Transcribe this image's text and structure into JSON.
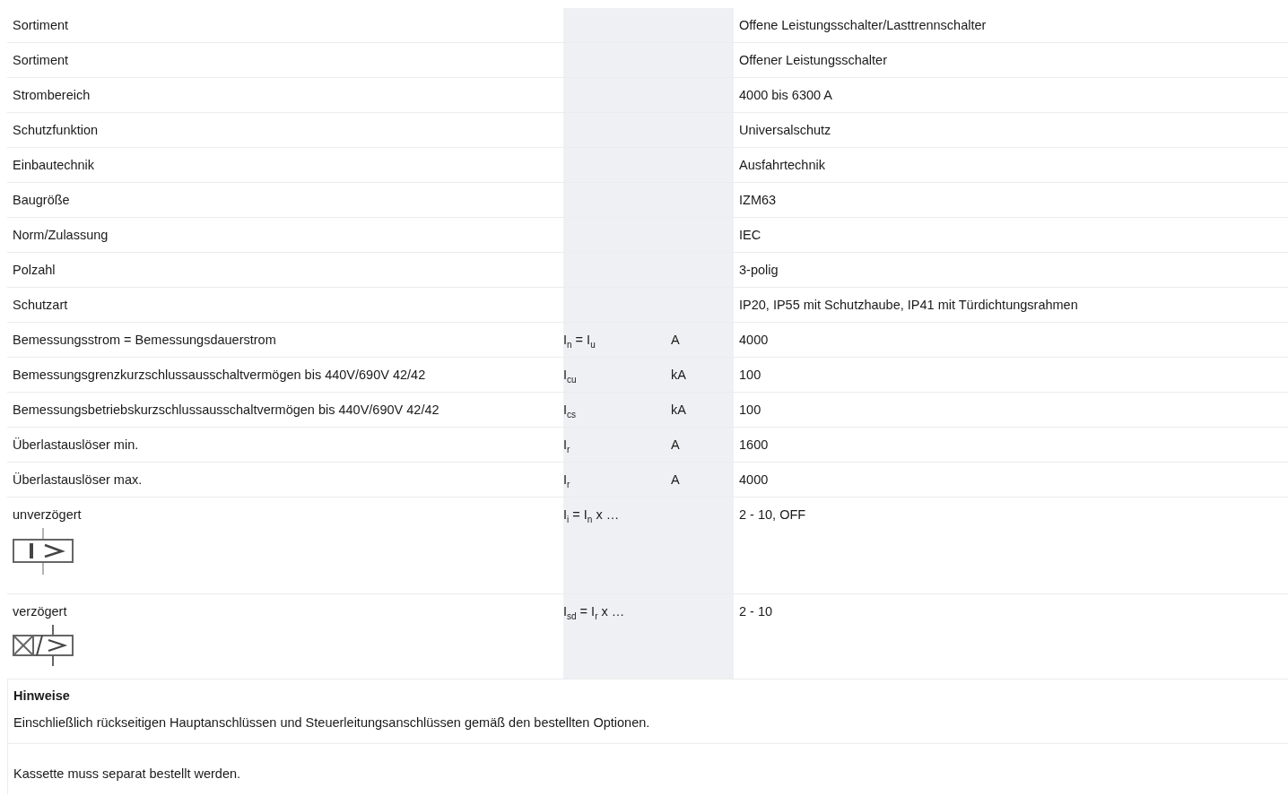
{
  "rows": [
    {
      "kind": "plain",
      "label": "Sortiment",
      "symbol": "",
      "unit": "",
      "value": "Offene Leistungsschalter/Lasttrennschalter"
    },
    {
      "kind": "plain",
      "label": "Sortiment",
      "symbol": "",
      "unit": "",
      "value": "Offener Leistungsschalter"
    },
    {
      "kind": "plain",
      "label": "Strombereich",
      "symbol": "",
      "unit": "",
      "value": "4000 bis 6300 A"
    },
    {
      "kind": "plain",
      "label": "Schutzfunktion",
      "symbol": "",
      "unit": "",
      "value": "Universalschutz"
    },
    {
      "kind": "plain",
      "label": "Einbautechnik",
      "symbol": "",
      "unit": "",
      "value": "Ausfahrtechnik"
    },
    {
      "kind": "plain",
      "label": "Baugröße",
      "symbol": "",
      "unit": "",
      "value": "IZM63"
    },
    {
      "kind": "plain",
      "label": "Norm/Zulassung",
      "symbol": "",
      "unit": "",
      "value": "IEC"
    },
    {
      "kind": "plain",
      "label": "Polzahl",
      "symbol": "",
      "unit": "",
      "value": "3-polig"
    },
    {
      "kind": "plain",
      "label": "Schutzart",
      "symbol": "",
      "unit": "",
      "value": "IP20, IP55 mit Schutzhaube, IP41 mit Türdichtungsrahmen"
    },
    {
      "kind": "plain",
      "label": "Bemessungsstrom = Bemessungsdauerstrom",
      "symbol": "I$_{n}$ = I$_{u}$",
      "unit": "A",
      "value": "4000"
    },
    {
      "kind": "plain",
      "label": "Bemessungsgrenzkurzschlussausschaltvermögen bis 440V/690V 42/42",
      "symbol": "I$_{cu}$",
      "unit": "kA",
      "value": "100"
    },
    {
      "kind": "plain",
      "label": "Bemessungsbetriebskurzschlussausschaltvermögen bis 440V/690V 42/42",
      "symbol": "I$_{cs}$",
      "unit": "kA",
      "value": "100"
    },
    {
      "kind": "plain",
      "label": "Überlastauslöser min.",
      "symbol": "I$_{r}$",
      "unit": "A",
      "value": "1600"
    },
    {
      "kind": "plain",
      "label": "Überlastauslöser max.",
      "symbol": "I$_{r}$",
      "unit": "A",
      "value": "4000"
    },
    {
      "kind": "instant",
      "label": "unverzögert",
      "symbol": "I$_{i}$ = I$_{n}$ x …",
      "unit": "",
      "value": "2 - 10, OFF"
    },
    {
      "kind": "delayed",
      "label": "verzögert",
      "symbol": "I$_{sd}$ = I$_{r}$ x …",
      "unit": "",
      "value": "2 - 10"
    }
  ],
  "notes": {
    "heading": "Hinweise",
    "items": [
      "Einschließlich rückseitigen Hauptanschlüssen und Steuerleitungsanschlüssen gemäß den bestellten Optionen.",
      "Kassette muss separat bestellt werden."
    ]
  }
}
